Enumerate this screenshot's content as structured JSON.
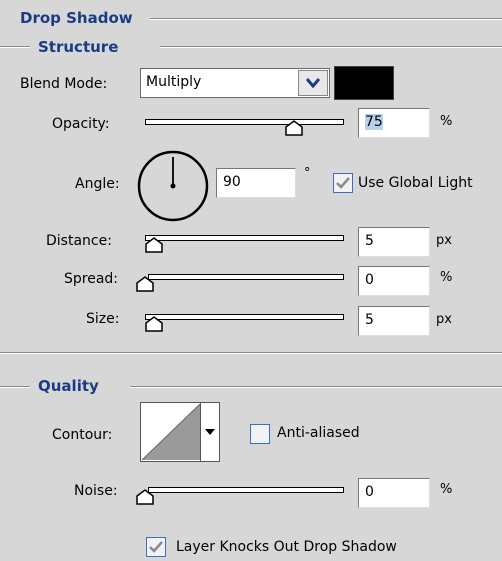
{
  "panel_title": "Drop Shadow",
  "structure": {
    "title": "Structure",
    "blend_mode_label": "Blend Mode:",
    "blend_mode_value": "Multiply",
    "blend_color": "#000000",
    "opacity_label": "Opacity:",
    "opacity_value": "75",
    "opacity_unit": "%",
    "opacity_level": 0.75,
    "angle_label": "Angle:",
    "angle_value": "90",
    "angle_unit": "°",
    "use_global_light_label": "Use Global Light",
    "use_global_light_checked": true,
    "distance_label": "Distance:",
    "distance_value": "5",
    "distance_unit": "px",
    "spread_label": "Spread:",
    "spread_value": "0",
    "spread_unit": "%",
    "size_label": "Size:",
    "size_value": "5",
    "size_unit": "px"
  },
  "quality": {
    "title": "Quality",
    "contour_label": "Contour:",
    "anti_aliased_label": "Anti-aliased",
    "anti_aliased_checked": false,
    "noise_label": "Noise:",
    "noise_value": "0",
    "noise_unit": "%"
  },
  "layer_knocks_out_label": "Layer Knocks Out Drop Shadow",
  "layer_knocks_out_checked": true,
  "accent_color": "#1c3b86"
}
